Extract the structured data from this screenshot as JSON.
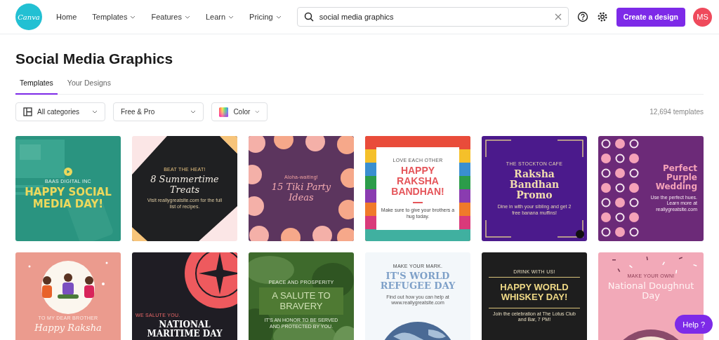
{
  "header": {
    "logo": "Canva",
    "nav": [
      {
        "label": "Home",
        "has_menu": false
      },
      {
        "label": "Templates",
        "has_menu": true
      },
      {
        "label": "Features",
        "has_menu": true
      },
      {
        "label": "Learn",
        "has_menu": true
      },
      {
        "label": "Pricing",
        "has_menu": true
      }
    ],
    "search": {
      "value": "social media graphics"
    },
    "create_button": "Create a design",
    "avatar": "MS"
  },
  "title": "Social Media Graphics",
  "tabs": [
    {
      "label": "Templates",
      "selected": true
    },
    {
      "label": "Your Designs",
      "selected": false
    }
  ],
  "filters": [
    {
      "kind": "category",
      "label": "All categories"
    },
    {
      "kind": "plain",
      "label": "Free & Pro"
    },
    {
      "kind": "color",
      "label": "Color"
    }
  ],
  "count": "12,694 templates",
  "cards": [
    {
      "kind": "social",
      "tagline": "BAAS DIGITAL INC",
      "title": "HAPPY SOCIAL MEDIA DAY!"
    },
    {
      "kind": "summer",
      "tagline": "BEAT THE HEAT!",
      "title": "8 Summertime Treats",
      "body": "Visit reallygreatsite.com for the full list of recipes."
    },
    {
      "kind": "tiki",
      "tagline": "Aloha-waiting!",
      "title": "15 Tiki Party Ideas"
    },
    {
      "kind": "raksha-photo",
      "tagline": "LOVE EACH OTHER",
      "title": "HAPPY RAKSHA BANDHAN!",
      "body": "Make sure to give your brothers a hug today."
    },
    {
      "kind": "raksha-promo",
      "tagline": "THE STOCKTON CAFE",
      "title": "Raksha Bandhan Promo",
      "body": "Dine in with your sibling and get 2 free banana muffins!"
    },
    {
      "kind": "wedding",
      "title": "Perfect Purple Wedding",
      "body": "Use the perfect hues. Learn more at reallygreatsite.com"
    },
    {
      "kind": "raksha-kids",
      "tagline": "TO MY DEAR BROTHER",
      "title": "Happy Raksha"
    },
    {
      "kind": "maritime",
      "tagline": "WE SALUTE YOU.",
      "title": "NATIONAL MARITIME DAY"
    },
    {
      "kind": "bravery",
      "tagline": "PEACE AND PROSPERITY",
      "title": "A SALUTE TO BRAVERY",
      "body": "IT'S AN HONOR TO BE SERVED AND PROTECTED BY YOU."
    },
    {
      "kind": "refugee",
      "tagline": "MAKE YOUR MARK.",
      "title": "IT'S WORLD REFUGEE DAY",
      "body": "Find out how you can help at www.reallygreatsite.com"
    },
    {
      "kind": "whiskey",
      "tagline": "DRINK WITH US!",
      "title": "HAPPY WORLD WHISKEY DAY!",
      "body": "Join the celebration at The Lotus Club and Bar, 7 PM!"
    },
    {
      "kind": "doughnut",
      "tagline": "MAKE YOUR OWN!",
      "title": "National Doughnut Day"
    }
  ],
  "help_button": "Help ?"
}
